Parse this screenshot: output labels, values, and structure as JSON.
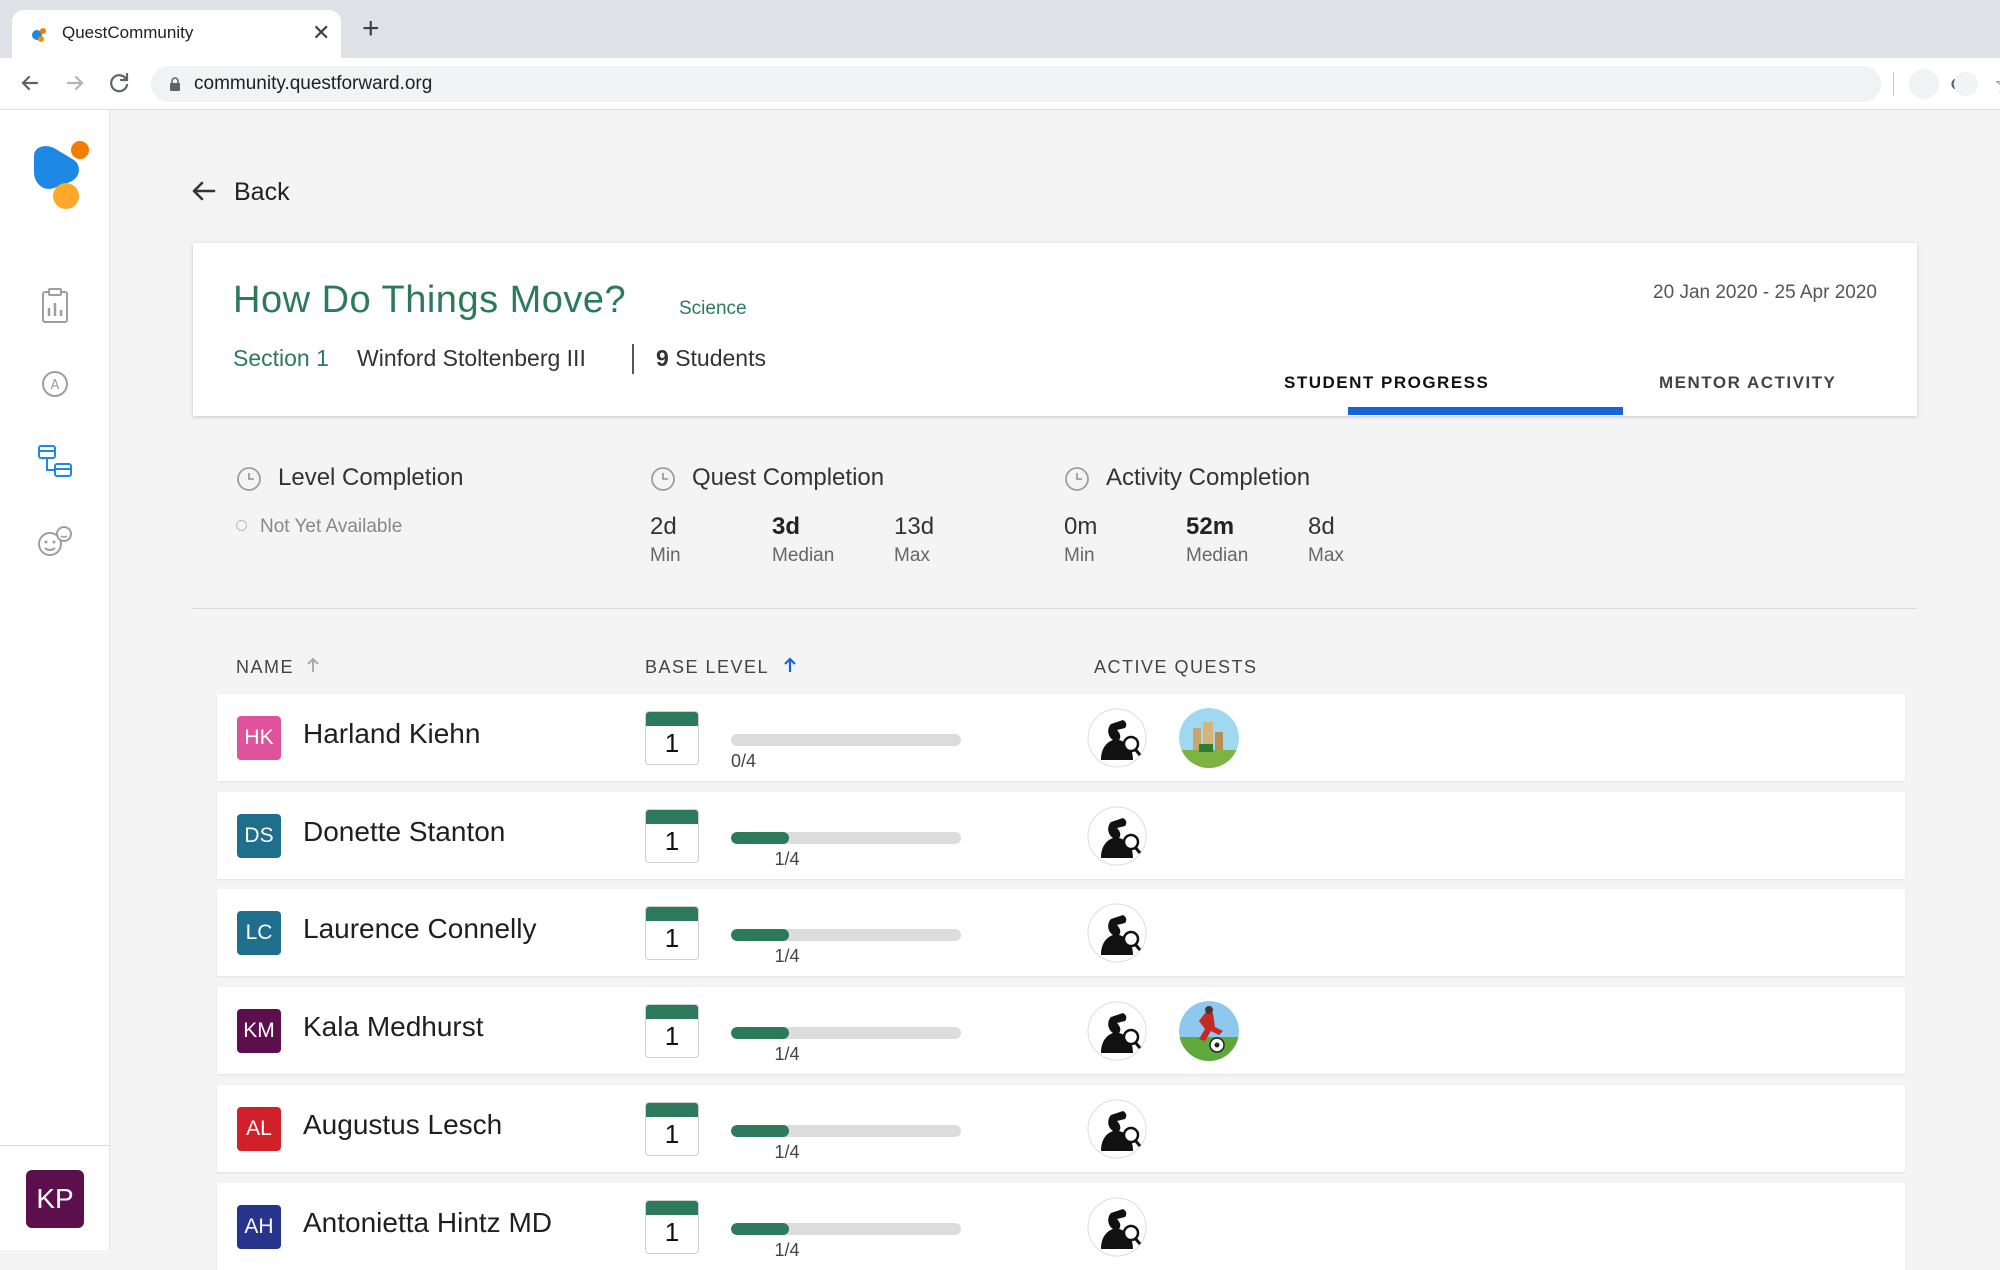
{
  "browser": {
    "tab_title": "QuestCommunity",
    "tab_close": "✕",
    "new_tab": "+",
    "url": "community.questforward.org"
  },
  "back_label": "Back",
  "course": {
    "title": "How Do Things Move?",
    "subject": "Science",
    "section": "Section 1",
    "mentor": "Winford Stoltenberg III",
    "students_count": "9",
    "students_label": "Students",
    "date_range": "20 Jan 2020 - 25 Apr 2020",
    "tabs": [
      "STUDENT PROGRESS",
      "MENTOR ACTIVITY"
    ]
  },
  "stats": {
    "level": {
      "title": "Level Completion",
      "status": "Not Yet Available"
    },
    "quest": {
      "title": "Quest Completion",
      "metrics": [
        {
          "value": "2d",
          "label": "Min"
        },
        {
          "value": "3d",
          "label": "Median"
        },
        {
          "value": "13d",
          "label": "Max"
        }
      ]
    },
    "activity": {
      "title": "Activity Completion",
      "metrics": [
        {
          "value": "0m",
          "label": "Min"
        },
        {
          "value": "52m",
          "label": "Median"
        },
        {
          "value": "8d",
          "label": "Max"
        }
      ]
    }
  },
  "table": {
    "headers": {
      "name": "NAME",
      "base_level": "BASE LEVEL",
      "active_quests": "ACTIVE QUESTS"
    },
    "rows": [
      {
        "initials": "HK",
        "name": "Harland Kiehn",
        "color": "#e0529c",
        "level": "1",
        "progress": "0/4",
        "progress_fraction": 0.0,
        "quests": [
          "detective-quest-icon",
          "city-quest-icon"
        ]
      },
      {
        "initials": "DS",
        "name": "Donette Stanton",
        "color": "#1e6e8c",
        "level": "1",
        "progress": "1/4",
        "progress_fraction": 0.25,
        "quests": [
          "detective-quest-icon"
        ]
      },
      {
        "initials": "LC",
        "name": "Laurence Connelly",
        "color": "#1e6e8c",
        "level": "1",
        "progress": "1/4",
        "progress_fraction": 0.25,
        "quests": [
          "detective-quest-icon"
        ]
      },
      {
        "initials": "KM",
        "name": "Kala Medhurst",
        "color": "#5c0f4d",
        "level": "1",
        "progress": "1/4",
        "progress_fraction": 0.25,
        "quests": [
          "detective-quest-icon",
          "soccer-quest-icon"
        ]
      },
      {
        "initials": "AL",
        "name": "Augustus Lesch",
        "color": "#d0202a",
        "level": "1",
        "progress": "1/4",
        "progress_fraction": 0.25,
        "quests": [
          "detective-quest-icon"
        ]
      },
      {
        "initials": "AH",
        "name": "Antonietta Hintz MD",
        "color": "#27348b",
        "level": "1",
        "progress": "1/4",
        "progress_fraction": 0.25,
        "quests": [
          "detective-quest-icon"
        ]
      }
    ]
  },
  "user": {
    "initials": "KP"
  },
  "colors": {
    "accent_green": "#2c7a5b",
    "tab_blue": "#1565d8",
    "avatar_purple": "#5c0f4d"
  }
}
